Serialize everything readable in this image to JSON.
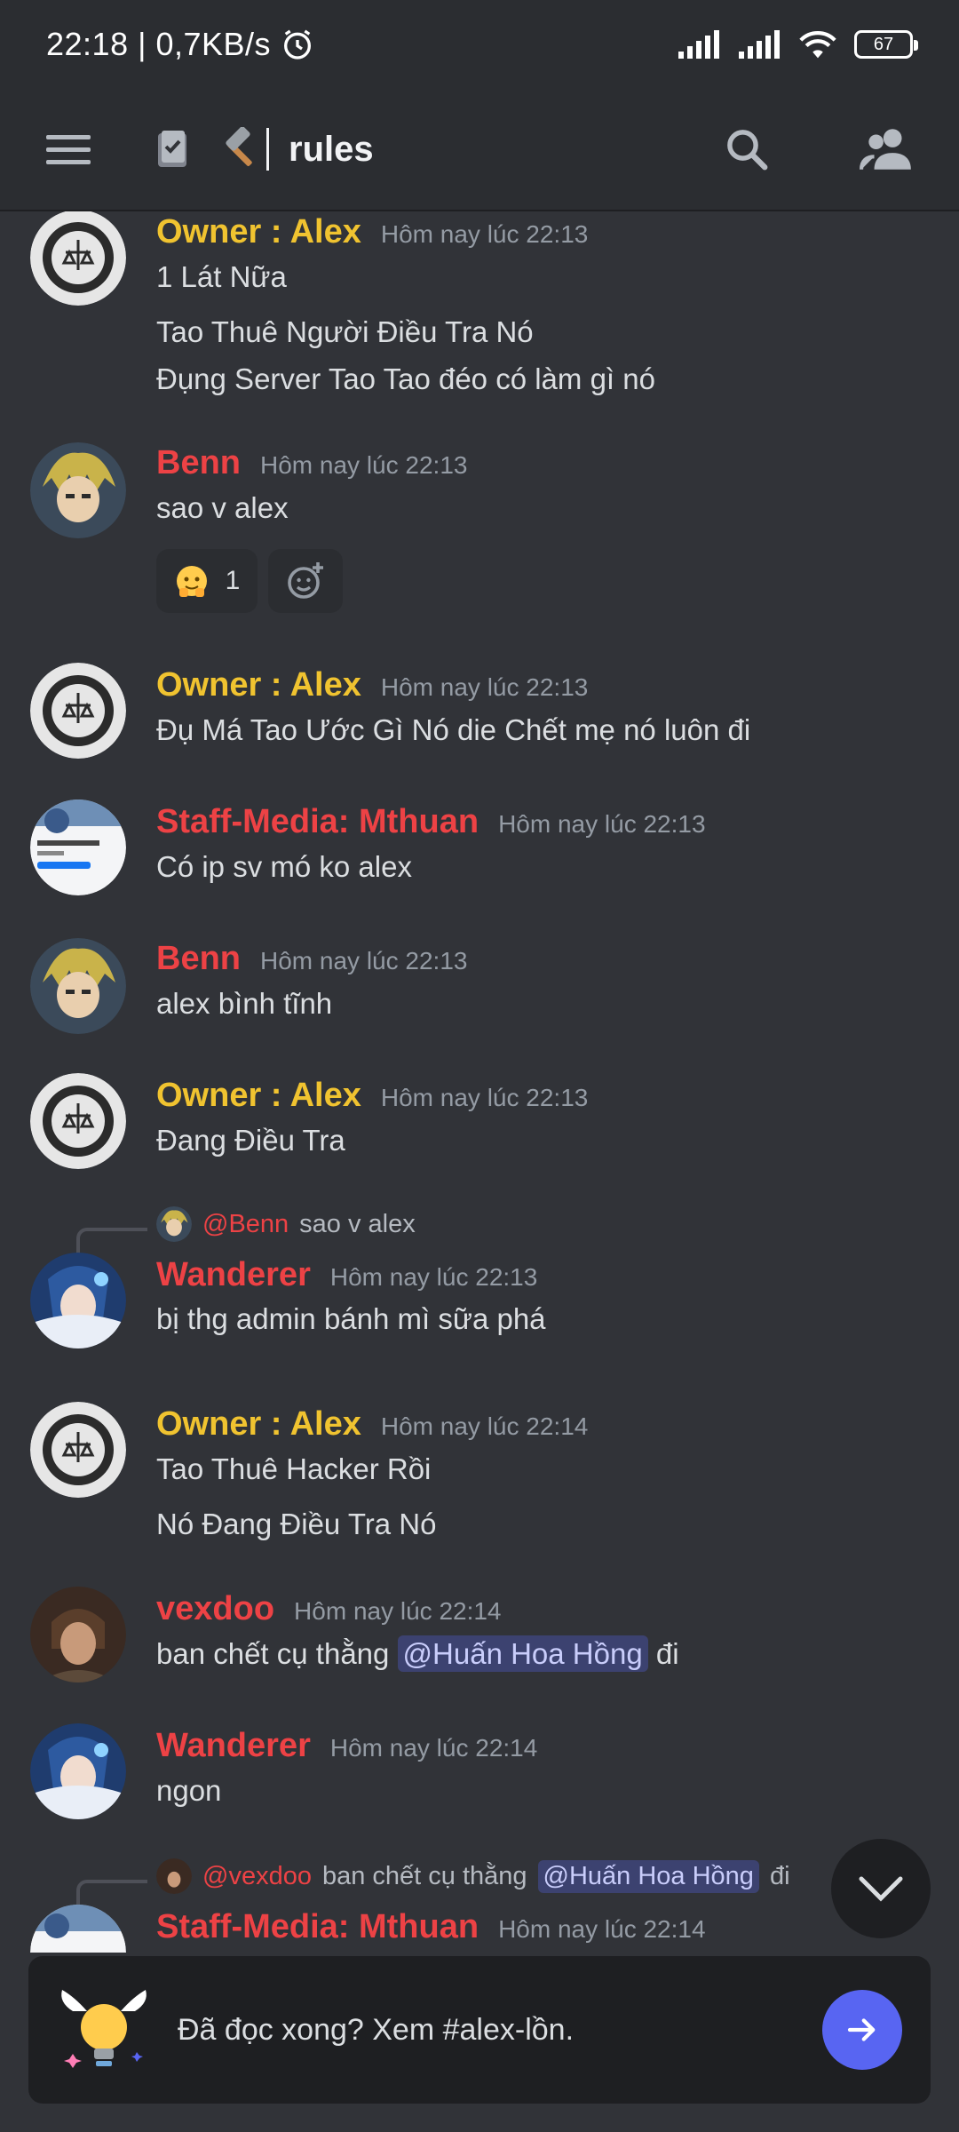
{
  "statusbar": {
    "time": "22:18 | 0,7KB/s",
    "battery": "67",
    "icons": [
      "alarm-icon",
      "signal-icon",
      "signal-icon",
      "wifi-icon",
      "battery-icon"
    ]
  },
  "header": {
    "channel": "rules",
    "icons": [
      "menu-icon",
      "rules-channel-icon",
      "hammer-icon",
      "search-icon",
      "members-icon"
    ]
  },
  "colors": {
    "owner": "#f0c330",
    "red": "#ed4245",
    "background": "#313338",
    "panel": "#2b2d31",
    "accent": "#5865f2"
  },
  "messages": [
    {
      "author": "Owner : Alex",
      "time": "Hôm nay lúc 22:13",
      "lines": [
        "1 Lát Nữa",
        "Tao Thuê Người Điều Tra Nó",
        "Đụng Server Tao Tao đéo có làm gì nó"
      ]
    },
    {
      "author": "Benn",
      "time": "Hôm nay lúc 22:13",
      "lines": [
        "sao v alex"
      ],
      "reaction_count": "1"
    },
    {
      "author": "Owner : Alex",
      "time": "Hôm nay lúc 22:13",
      "lines": [
        "Đụ Má Tao Ước Gì Nó die Chết mẹ nó luôn đi"
      ]
    },
    {
      "author": "Staff-Media: Mthuan",
      "time": "Hôm nay lúc 22:13",
      "lines": [
        "Có ip sv mó ko alex"
      ]
    },
    {
      "author": "Benn",
      "time": "Hôm nay lúc 22:13",
      "lines": [
        "alex bình tĩnh"
      ]
    },
    {
      "author": "Owner : Alex",
      "time": "Hôm nay lúc 22:13",
      "lines": [
        "Đang Điều Tra"
      ]
    },
    {
      "author": "Wanderer",
      "time": "Hôm nay lúc 22:13",
      "reply_to": "@Benn",
      "reply_text": "sao v alex",
      "lines": [
        "bị thg admin bánh mì sữa phá"
      ]
    },
    {
      "author": "Owner : Alex",
      "time": "Hôm nay lúc 22:14",
      "lines": [
        "Tao Thuê Hacker Rồi",
        "Nó Đang Điều Tra Nó"
      ]
    },
    {
      "author": "vexdoo",
      "time": "Hôm nay lúc 22:14",
      "line_before": "ban chết cụ thằng",
      "mention": "@Huấn Hoa Hồng",
      "line_after": "đi"
    },
    {
      "author": "Wanderer",
      "time": "Hôm nay lúc 22:14",
      "lines": [
        "ngon"
      ]
    },
    {
      "author": "Staff-Media: Mthuan",
      "time": "Hôm nay lúc 22:14",
      "reply_to": "@vexdoo",
      "reply_text_before": "ban chết cụ thằng",
      "reply_mention": "@Huấn Hoa Hồng",
      "reply_text_after": "đi"
    }
  ],
  "bottom_card": {
    "text": "Đã đọc xong? Xem #alex-lồn."
  }
}
